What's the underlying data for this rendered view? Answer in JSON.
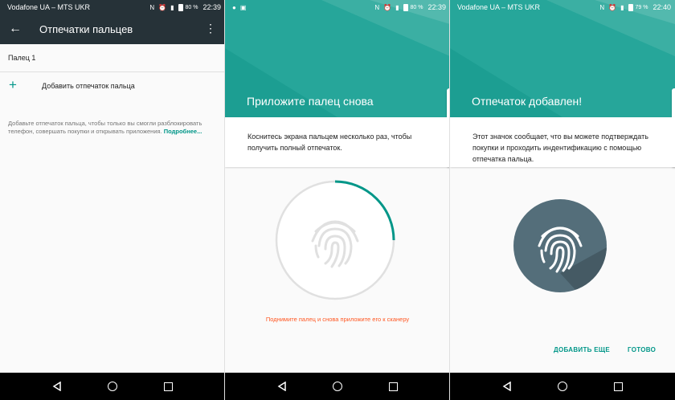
{
  "screen1": {
    "statusbar": {
      "carrier": "Vodafone UA – MTS UKR",
      "battery_pct": "80 %",
      "time": "22:39"
    },
    "appbar": {
      "title": "Отпечатки пальцев",
      "back_icon": "arrow-left-icon",
      "menu_icon": "more-vert-icon"
    },
    "fingers": [
      "Палец 1"
    ],
    "add_label": "Добавить отпечаток пальца",
    "description": "Добавьте отпечаток пальца, чтобы только вы смогли разблокировать телефон, совершать покупки и открывать приложения.",
    "more_link": "Подробнее..."
  },
  "screen2": {
    "statusbar": {
      "battery_pct": "80 %",
      "time": "22:39"
    },
    "heading": "Приложите палец снова",
    "instruction": "Коснитесь экрана пальцем несколько раз, чтобы получить полный отпечаток.",
    "progress": 0.25,
    "warning": "Поднимите палец и снова приложите его к сканеру"
  },
  "screen3": {
    "statusbar": {
      "carrier": "Vodafone UA – MTS UKR",
      "battery_pct": "79 %",
      "time": "22:40"
    },
    "heading": "Отпечаток добавлен!",
    "info": "Этот значок сообщает, что вы можете подтверждать покупки и проходить индентификацию с помощью отпечатка пальца.",
    "add_more_label": "ДОБАВИТЬ ЕЩЕ",
    "done_label": "ГОТОВО"
  },
  "colors": {
    "accent": "#009688",
    "teal_header": "#26a69a",
    "appbar": "#263238",
    "warning": "#ff5722",
    "disc": "#546e7a"
  }
}
